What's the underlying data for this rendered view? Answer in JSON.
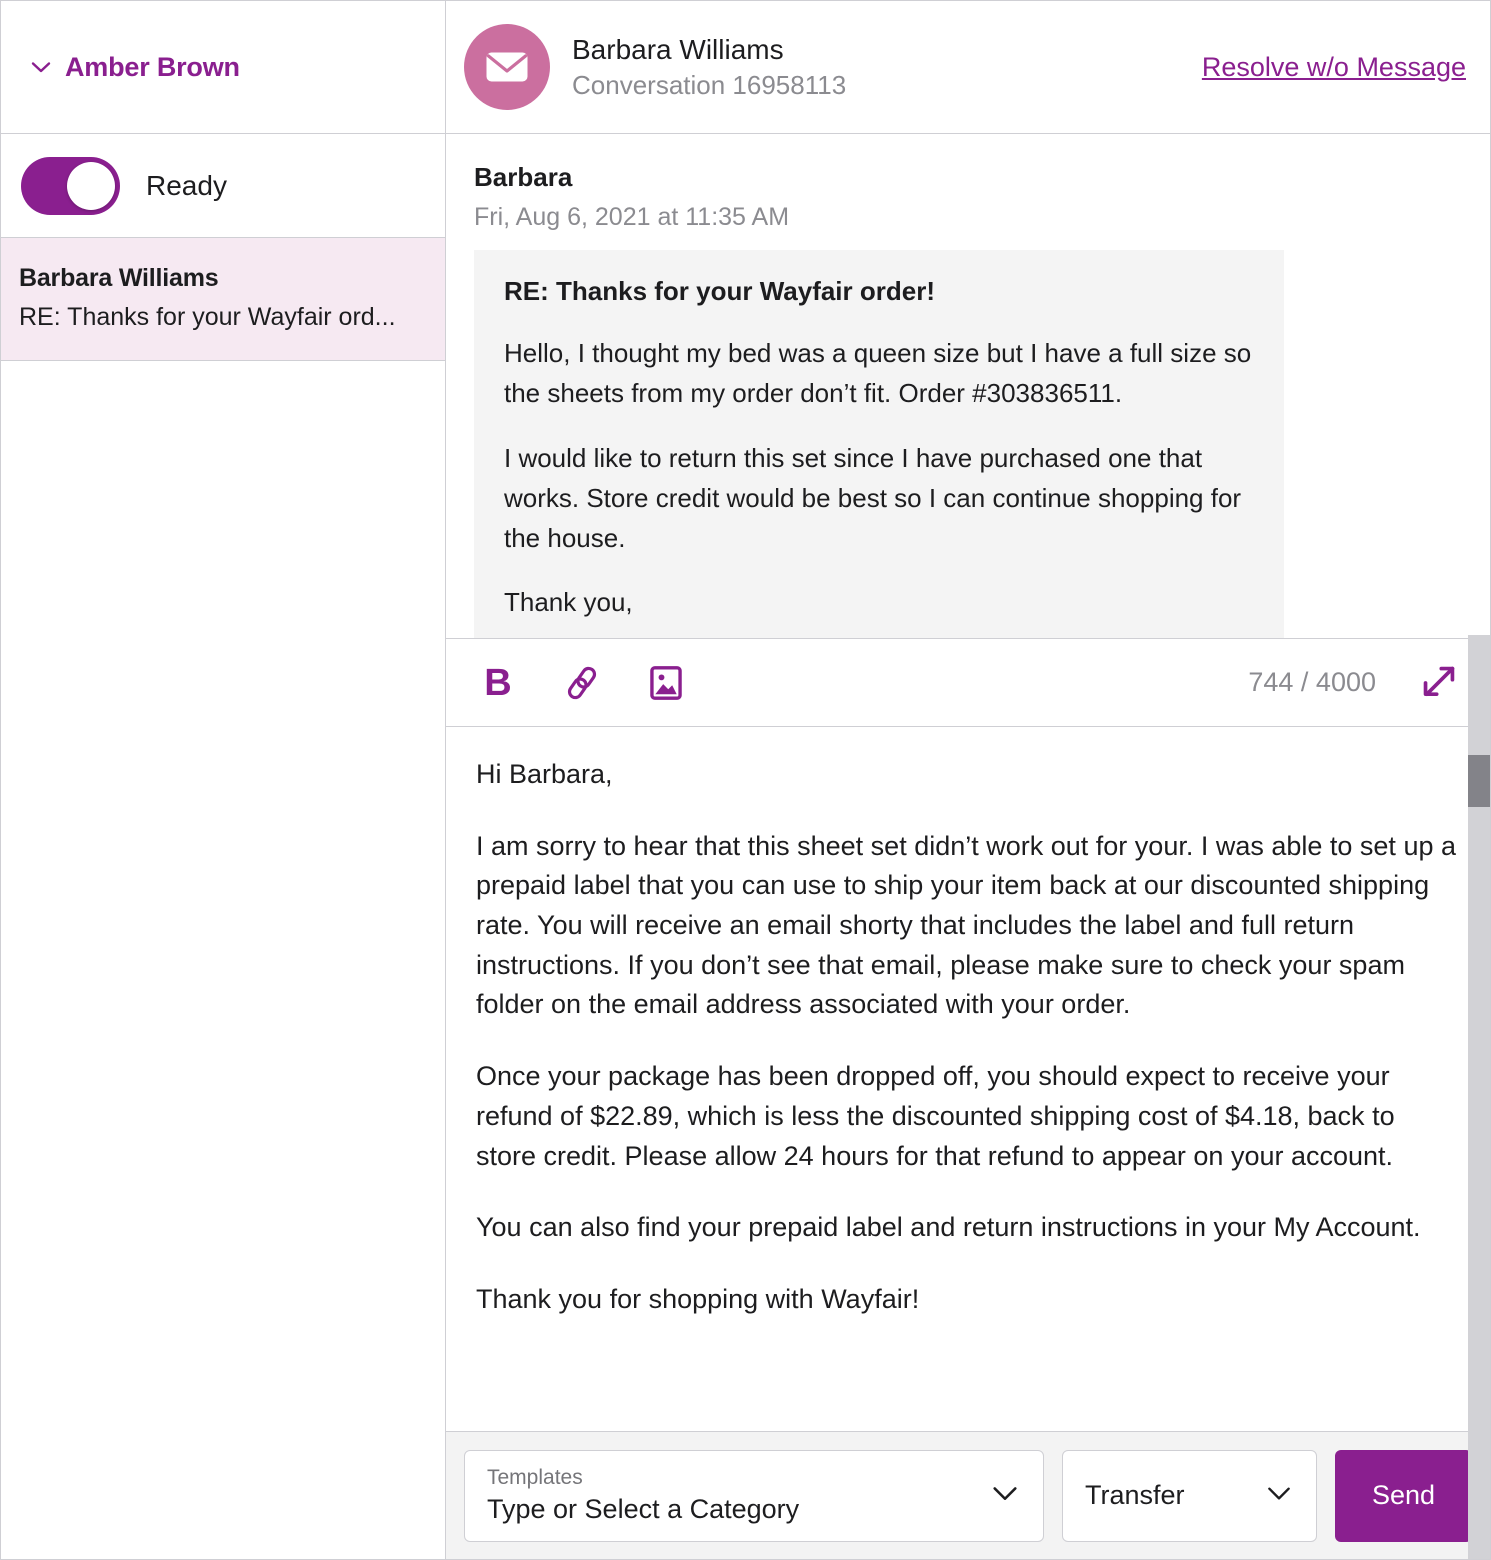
{
  "sidebar": {
    "agent": {
      "name": "Amber Brown",
      "chevron_icon": "chevron-down-icon"
    },
    "status": {
      "label": "Ready",
      "toggle_on": true
    },
    "conversations": [
      {
        "title": "Barbara Williams",
        "snippet": "RE: Thanks for your Wayfair ord...",
        "selected": true
      }
    ]
  },
  "conversation": {
    "avatar_icon": "envelope-icon",
    "contact": "Barbara Williams",
    "subtitle": "Conversation 16958113",
    "resolve_link": "Resolve w/o Message"
  },
  "message": {
    "sender": "Barbara",
    "timestamp": "Fri, Aug 6, 2021 at 11:35 AM",
    "subject": "RE: Thanks for your Wayfair order!",
    "paragraphs": [
      "Hello, I thought my bed was a queen size but I have a full size so the sheets from my order don’t fit. Order #303836511.",
      "I would like to return this set since I have purchased one that works. Store credit would be best so I can continue shopping for the house.",
      "Thank you,"
    ]
  },
  "compose_toolbar": {
    "bold_label": "B",
    "bold_icon": "bold-icon",
    "link_icon": "link-icon",
    "image_icon": "image-icon",
    "char_count": "744 / 4000",
    "expand_icon": "expand-icon"
  },
  "reply": {
    "paragraphs": [
      "Hi Barbara,",
      "I am sorry to hear that this sheet set didn’t work out for your. I was able to set up a prepaid label that you can use to ship your item back at our discounted shipping rate. You will receive an email shorty that includes the label and full return instructions. If you don’t see that email, please make sure to check your spam folder on the email address associated with your order.",
      "Once your package has been dropped off, you should expect to receive your refund of $22.89, which is less the discounted shipping cost of $4.18, back to store credit. Please allow 24 hours for that refund to appear on your account.",
      "You can also find your prepaid label and return instructions in your My Account.",
      "Thank you for shopping with Wayfair!"
    ]
  },
  "action_bar": {
    "templates_label": "Templates",
    "templates_value": "Type or Select a Category",
    "templates_chevron_icon": "chevron-down-icon",
    "transfer_label": "Transfer",
    "transfer_chevron_icon": "chevron-down-icon",
    "send_label": "Send"
  },
  "colors": {
    "brand_purple": "#8a1f8f",
    "avatar_pink": "#cb6f9f",
    "selected_row": "#f6e9f2",
    "bubble_gray": "#f4f4f4",
    "action_bar_gray": "#f3f3f3",
    "border_gray": "#cfcfd4",
    "muted_text": "#8b8b90"
  }
}
